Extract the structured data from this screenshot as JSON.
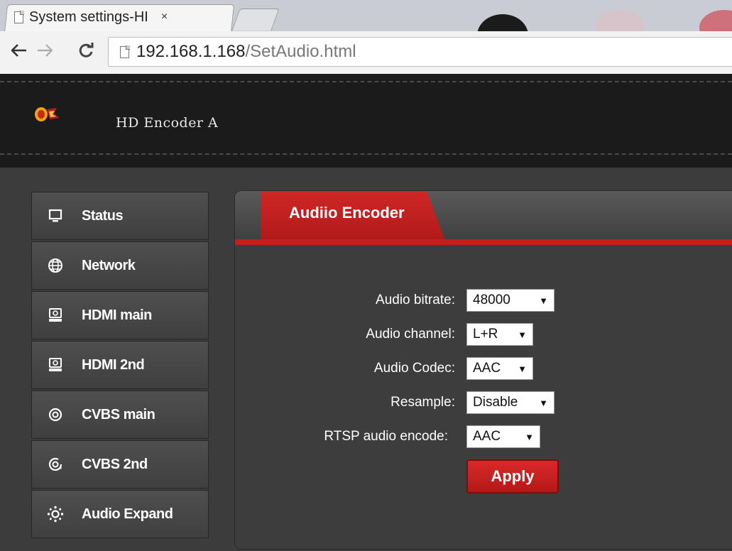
{
  "browser": {
    "tab_title": "System settings-HI",
    "tab_close": "×",
    "url_host": "192.168.1.168",
    "url_path": "/SetAudio.html"
  },
  "header": {
    "title": "HD Encoder  A"
  },
  "sidebar": {
    "items": [
      {
        "label": "Status",
        "icon": "monitor-icon"
      },
      {
        "label": "Network",
        "icon": "globe-icon"
      },
      {
        "label": "HDMI main",
        "icon": "hdmi-icon"
      },
      {
        "label": "HDMI 2nd",
        "icon": "hdmi-icon"
      },
      {
        "label": "CVBS main",
        "icon": "cvbs-icon"
      },
      {
        "label": "CVBS 2nd",
        "icon": "cvbs-icon"
      },
      {
        "label": "Audio Expand",
        "icon": "audio-expand-icon"
      }
    ]
  },
  "panel": {
    "tab_label": "Audiio Encoder",
    "fields": {
      "bitrate": {
        "label": "Audio bitrate:",
        "value": "48000"
      },
      "channel": {
        "label": "Audio channel:",
        "value": "L+R"
      },
      "codec": {
        "label": "Audio Codec:",
        "value": "AAC"
      },
      "resample": {
        "label": "Resample:",
        "value": "Disable"
      },
      "rtsp": {
        "label": "RTSP audio encode:",
        "value": "AAC"
      }
    },
    "apply_label": "Apply"
  },
  "colors": {
    "accent_red": "#c41e1e",
    "header_bg": "#1b1b1b",
    "sidebar_bg": "#4a4a4a"
  }
}
